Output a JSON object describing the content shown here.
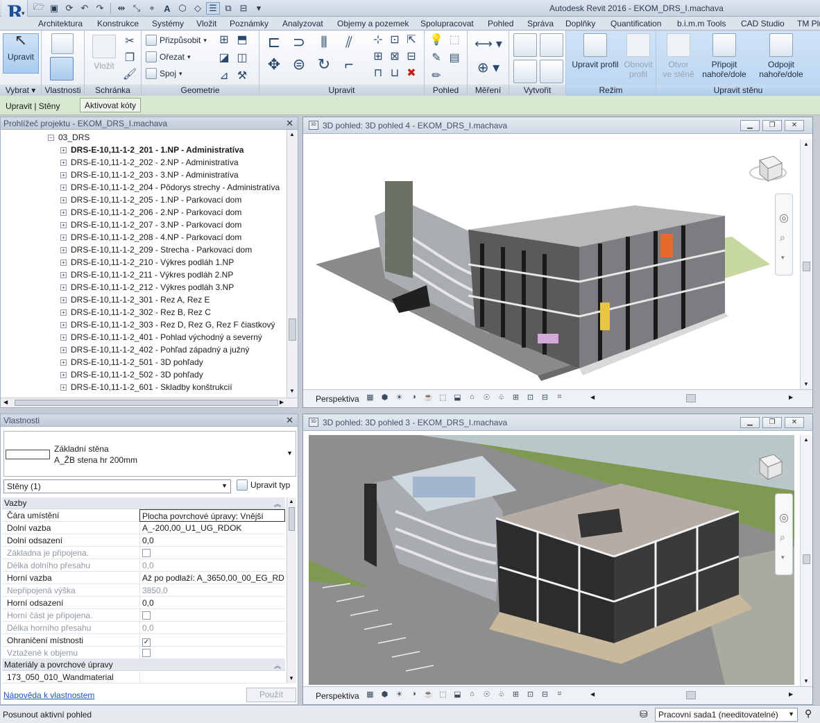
{
  "app": {
    "title": "Autodesk Revit 2016 -   EKOM_DRS_I.machava"
  },
  "menu": {
    "tabs": [
      "Architektura",
      "Konstrukce",
      "Systémy",
      "Vložit",
      "Poznámky",
      "Analyzovat",
      "Objemy a pozemek",
      "Spolupracovat",
      "Pohled",
      "Správa",
      "Doplňky",
      "Quantification",
      "b.i.m.m Tools",
      "CAD Studio",
      "TM Plu"
    ],
    "active_index": 14
  },
  "ribbon": {
    "select": {
      "button": "Upravit",
      "panel": "Vybrat ▾"
    },
    "properties_panel": "Vlastnosti",
    "clipboard": {
      "paste": "Vložit",
      "panel": "Schránka"
    },
    "geometry": {
      "cope": "Přizpůsobit",
      "cut": "Ořezat",
      "join": "Spoj",
      "panel": "Geometrie"
    },
    "modify_panel": "Upravit",
    "view_panel": "Pohled",
    "measure_panel": "Měření",
    "create_panel": "Vytvořit",
    "mode": {
      "edit_profile": "Upravit profil",
      "reset_profile_1": "Obnovit",
      "reset_profile_2": "profil",
      "panel": "Režim"
    },
    "modify_wall": {
      "opening_1": "Otvor",
      "opening_2": "ve stěně",
      "attach_1": "Připojit",
      "attach_2": "nahoře/dole",
      "detach_1": "Odpojit",
      "detach_2": "nahoře/dole",
      "panel": "Upravit stěnu"
    }
  },
  "context_bar": {
    "label": "Upravit | Stěny",
    "button": "Aktivovat kóty"
  },
  "project_browser": {
    "title": "Prohlížeč projektu - EKOM_DRS_I.machava",
    "folder": "03_DRS",
    "items": [
      "DRS-E-10,11-1-2_201 - 1.NP - Administratíva",
      "DRS-E-10,11-1-2_202 - 2.NP - Administratíva",
      "DRS-E-10,11-1-2_203 - 3.NP - Administratíva",
      "DRS-E-10,11-1-2_204 - Pôdorys strechy - Administratíva",
      "DRS-E-10,11-1-2_205 - 1.NP - Parkovací dom",
      "DRS-E-10,11-1-2_206 - 2.NP - Parkovací dom",
      "DRS-E-10,11-1-2_207 - 3.NP - Parkovací dom",
      "DRS-E-10,11-1-2_208 - 4.NP - Parkovací dom",
      "DRS-E-10,11-1-2_209 - Strecha - Parkovací dom",
      "DRS-E-10,11-1-2_210 - Výkres podláh 1.NP",
      "DRS-E-10,11-1-2_211 - Výkres podláh 2.NP",
      "DRS-E-10,11-1-2_212 - Výkres podláh 3.NP",
      "DRS-E-10,11-1-2_301 - Rez A, Rez E",
      "DRS-E-10,11-1-2_302 - Rez B, Rez C",
      "DRS-E-10,11-1-2_303 - Rez D, Rez G, Rez F čiastkový",
      "DRS-E-10,11-1-2_401 - Pohlad východný a severný",
      "DRS-E-10,11-1-2_402 - Pohľad západný a južný",
      "DRS-E-10,11-1-2_501 - 3D pohľady",
      "DRS-E-10,11-1-2_502 - 3D pohľady",
      "DRS-E-10,11-1-2_601 - Skladby konštrukcií"
    ]
  },
  "properties": {
    "title": "Vlastnosti",
    "family": "Základní stěna",
    "type": "A_ŽB stena hr 200mm",
    "instance_selector": "Stěny (1)",
    "edit_type": "Upravit typ",
    "groups": {
      "constraints": "Vazby",
      "materials": "Materiály a povrchové úpravy"
    },
    "rows": [
      {
        "key": "Čára umístění",
        "value": "Plocha povrchové úpravy: Vnější",
        "dim": false,
        "edit": true
      },
      {
        "key": "Dolní vazba",
        "value": "A_-200,00_U1_UG_RDOK",
        "dim": false
      },
      {
        "key": "Dolní odsazení",
        "value": "0,0",
        "dim": false
      },
      {
        "key": "Základna je připojena.",
        "value": "",
        "dim": true,
        "check": false
      },
      {
        "key": "Délka dolního přesahu",
        "value": "0,0",
        "dim": true
      },
      {
        "key": "Horní vazba",
        "value": "Až po podlaží: A_3650,00_00_EG_RD...",
        "dim": false
      },
      {
        "key": "Nepřipojená výška",
        "value": "3850,0",
        "dim": true
      },
      {
        "key": "Horní odsazení",
        "value": "0,0",
        "dim": false
      },
      {
        "key": "Horní část je připojena.",
        "value": "",
        "dim": true,
        "check": false
      },
      {
        "key": "Délka horního přesahu",
        "value": "0,0",
        "dim": true
      },
      {
        "key": "Ohraničení místnosti",
        "value": "",
        "dim": false,
        "check": true
      },
      {
        "key": "Vztažené k objemu",
        "value": "",
        "dim": true,
        "check": false
      }
    ],
    "material_row": "173_050_010_Wandmaterial",
    "help_link": "Nápověda k vlastnostem",
    "apply": "Použít"
  },
  "views": {
    "top_title": "3D pohled: 3D pohled 4 - EKOM_DRS_I.machava",
    "bottom_title": "3D pohled: 3D pohled 3 - EKOM_DRS_I.machava",
    "mode": "Perspektiva"
  },
  "status": {
    "message": "Posunout aktivní pohled",
    "workset": "Pracovní sada1 (needitovatelné)"
  }
}
